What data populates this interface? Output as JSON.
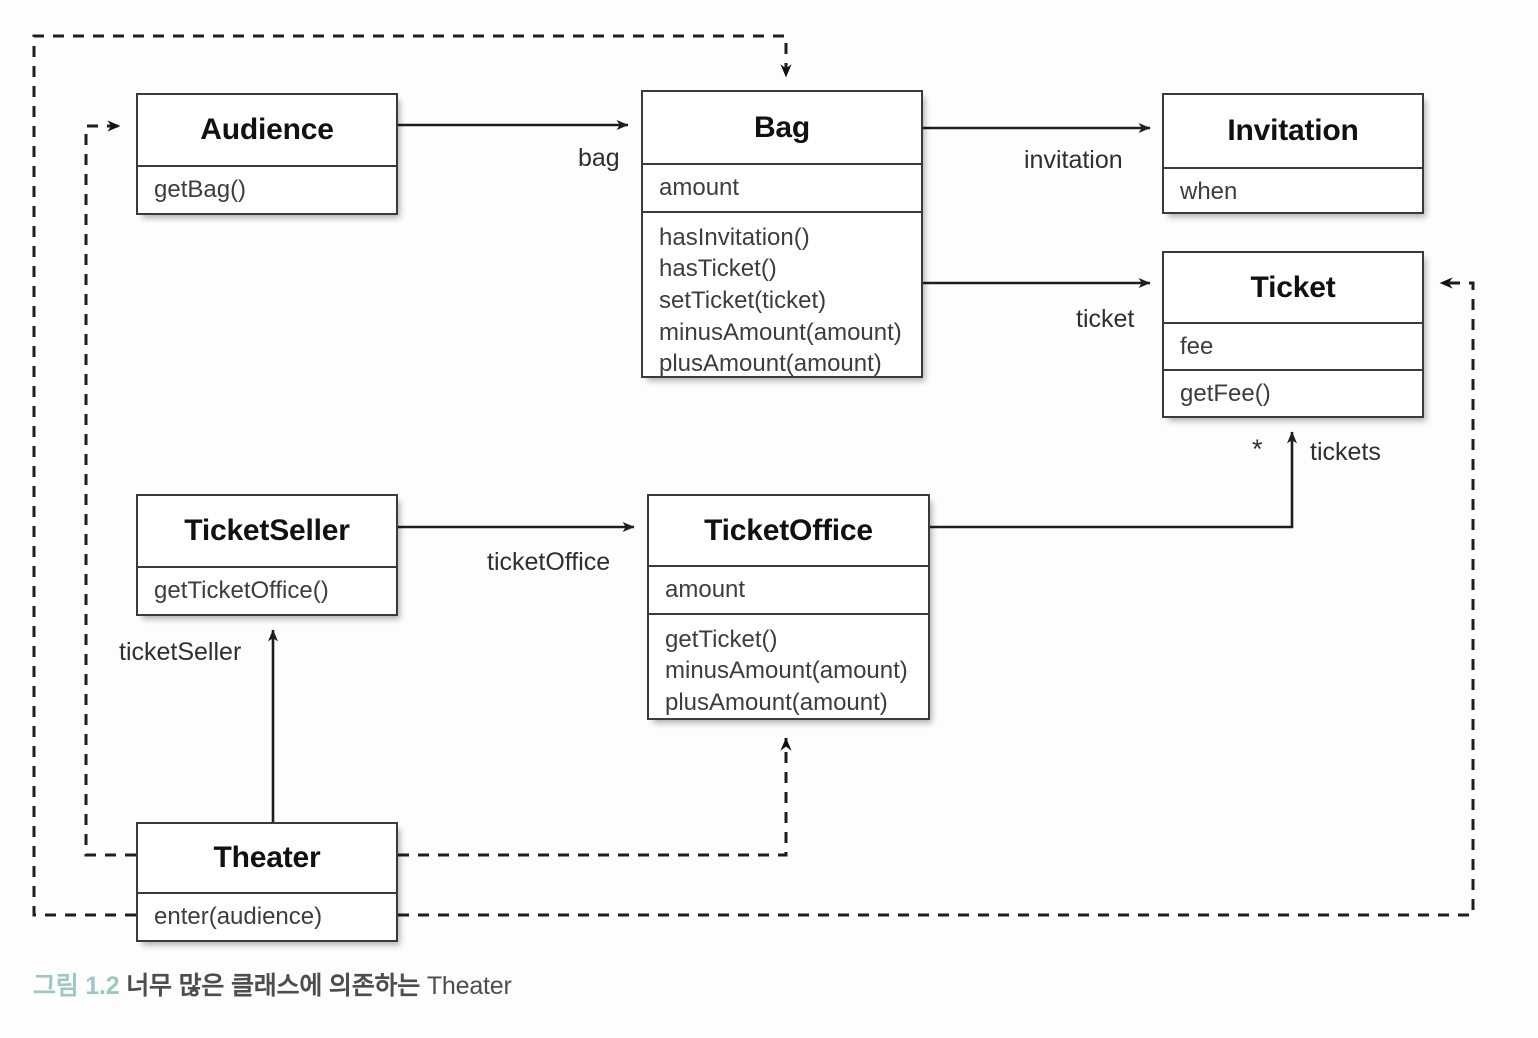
{
  "diagram": {
    "title": "Theater class dependency UML diagram",
    "classes": [
      {
        "id": "audience",
        "name": "Audience",
        "attributes": [],
        "operations": [
          "getBag()"
        ]
      },
      {
        "id": "bag",
        "name": "Bag",
        "attributes": [
          "amount"
        ],
        "operations": [
          "hasInvitation()",
          "hasTicket()",
          "setTicket(ticket)",
          "minusAmount(amount)",
          "plusAmount(amount)"
        ]
      },
      {
        "id": "invitation",
        "name": "Invitation",
        "attributes": [
          "when"
        ],
        "operations": []
      },
      {
        "id": "ticket",
        "name": "Ticket",
        "attributes": [
          "fee"
        ],
        "operations": [
          "getFee()"
        ]
      },
      {
        "id": "ticketseller",
        "name": "TicketSeller",
        "attributes": [],
        "operations": [
          "getTicketOffice()"
        ]
      },
      {
        "id": "ticketoffice",
        "name": "TicketOffice",
        "attributes": [
          "amount"
        ],
        "operations": [
          "getTicket()",
          "minusAmount(amount)",
          "plusAmount(amount)"
        ]
      },
      {
        "id": "theater",
        "name": "Theater",
        "attributes": [],
        "operations": [
          "enter(audience)"
        ]
      }
    ],
    "edge_labels": {
      "bag": "bag",
      "invitation": "invitation",
      "ticket": "ticket",
      "tickets": "tickets",
      "tickets_multiplicity": "*",
      "ticket_office": "ticketOffice",
      "ticket_seller": "ticketSeller"
    },
    "colors": {
      "box_border": "#3a3a3a",
      "line": "#1e1e1e",
      "text": "#2f2f2f",
      "caption_accent": "#9ec7c2"
    }
  },
  "caption": {
    "figure_number": "그림 1.2",
    "text": "너무 많은 클래스에 의존하는 ",
    "suffix": "Theater"
  }
}
